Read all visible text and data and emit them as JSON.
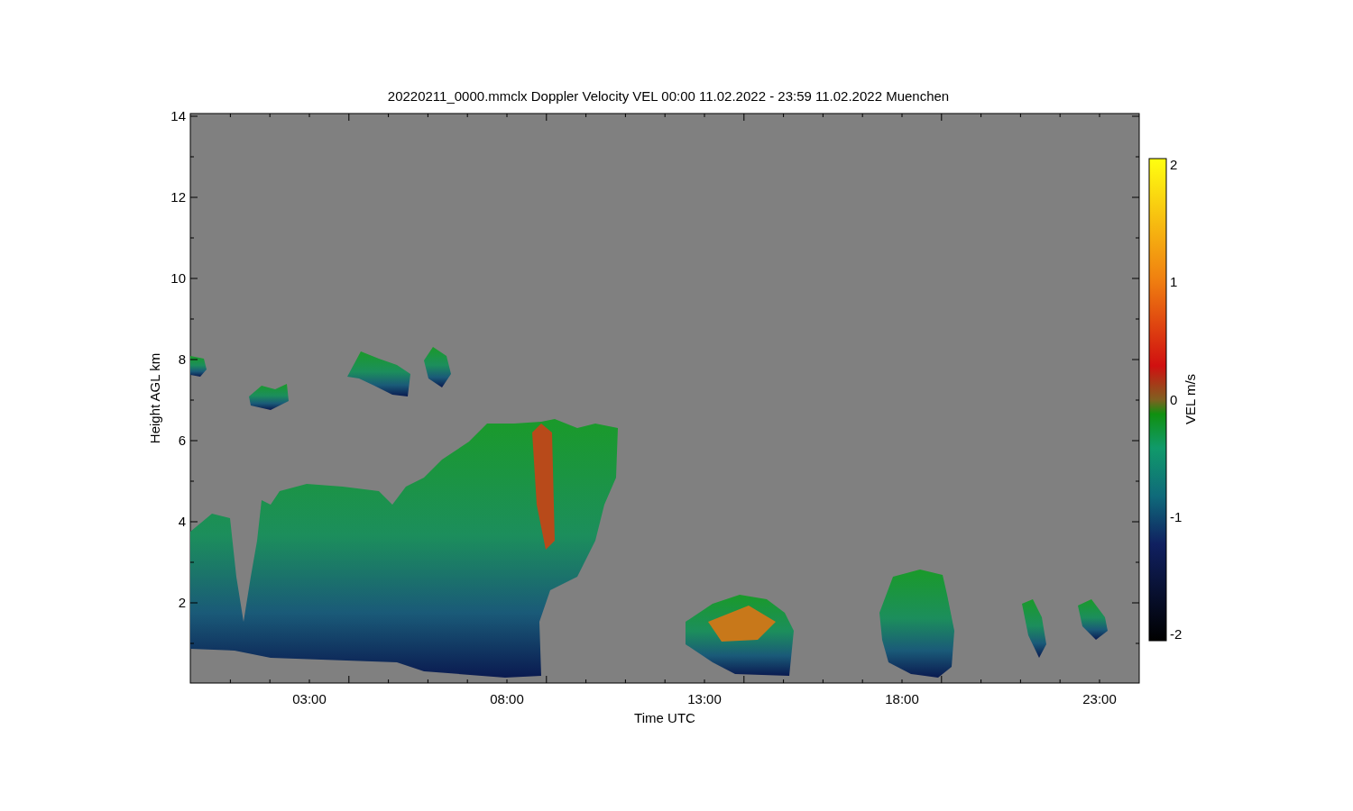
{
  "title": "20220211_0000.mmclx Doppler Velocity VEL   00:00 11.02.2022 - 23:59 11.02.2022 Muenchen",
  "y_axis": {
    "label": "Height AGL km",
    "ticks": [
      "14",
      "12",
      "10",
      "8",
      "6",
      "4",
      "2"
    ]
  },
  "x_axis": {
    "label": "Time UTC",
    "ticks": [
      "03:00",
      "08:00",
      "13:00",
      "18:00",
      "23:00"
    ]
  },
  "colorbar": {
    "label": "VEL m/s",
    "ticks": [
      "2",
      "1",
      "0",
      "-1",
      "-2"
    ]
  }
}
